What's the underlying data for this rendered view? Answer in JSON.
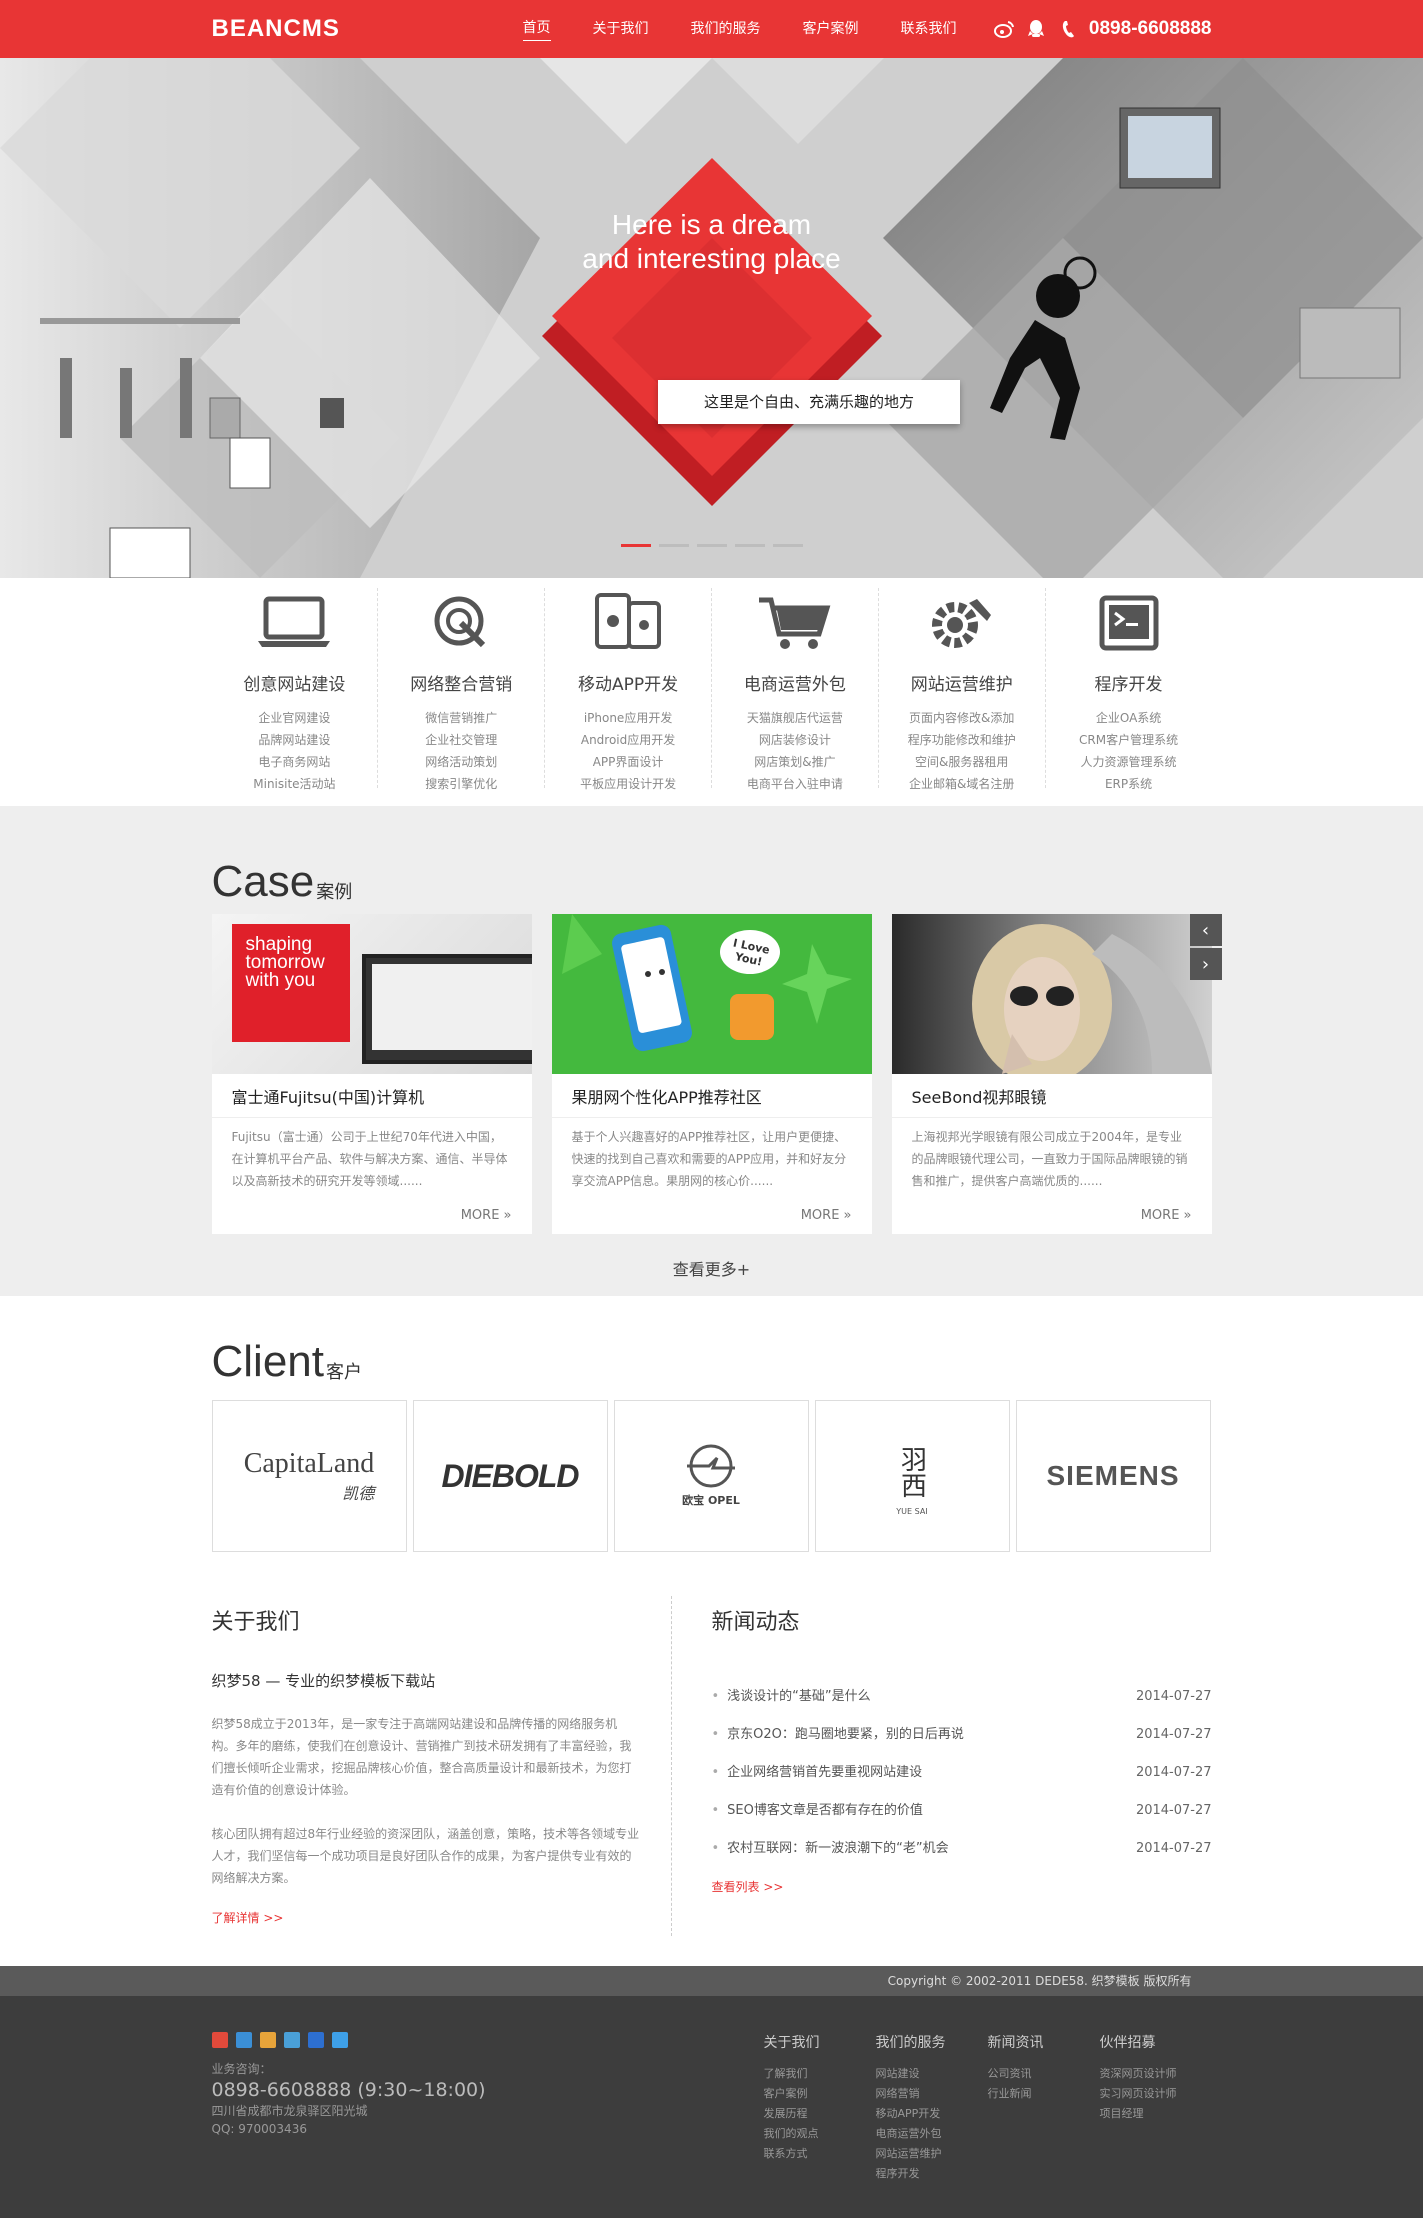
{
  "header": {
    "logo": "BEANCMS",
    "nav": [
      "首页",
      "关于我们",
      "我们的服务",
      "客户案例",
      "联系我们"
    ],
    "phone": "0898-6608888",
    "icons": [
      "weibo-icon",
      "qq-icon",
      "phone-icon"
    ]
  },
  "banner": {
    "headline_1": "Here is a dream",
    "headline_2": "and interesting place",
    "tag": "这里是个自由、充满乐趣的地方",
    "slide_count": 5,
    "active_slide": 1
  },
  "services": [
    {
      "icon": "laptop-icon",
      "title": "创意网站建设",
      "items": [
        "企业官网建设",
        "品牌网站建设",
        "电子商务网站",
        "Minisite活动站"
      ]
    },
    {
      "icon": "target-search-icon",
      "title": "网络整合营销",
      "items": [
        "微信营销推广",
        "企业社交管理",
        "网络活动策划",
        "搜索引擎优化"
      ]
    },
    {
      "icon": "mobile-app-icon",
      "title": "移动APP开发",
      "items": [
        "iPhone应用开发",
        "Android应用开发",
        "APP界面设计",
        "平板应用设计开发"
      ]
    },
    {
      "icon": "shopping-cart-icon",
      "title": "电商运营外包",
      "items": [
        "天猫旗舰店代运营",
        "网店装修设计",
        "网店策划&推广",
        "电商平台入驻申请"
      ]
    },
    {
      "icon": "gear-wrench-icon",
      "title": "网站运营维护",
      "items": [
        "页面内容修改&添加",
        "程序功能修改和维护",
        "空间&服务器租用",
        "企业邮箱&域名注册"
      ]
    },
    {
      "icon": "terminal-icon",
      "title": "程序开发",
      "items": [
        "企业OA系统",
        "CRM客户管理系统",
        "人力资源管理系统",
        "ERP系统"
      ]
    }
  ],
  "case": {
    "title_en": "Case",
    "title_cn": "案例",
    "cards": [
      {
        "title": "富士通Fujitsu(中国)计算机",
        "overlay": "shaping tomorrow with you",
        "desc": "Fujitsu（富士通）公司于上世纪70年代进入中国，在计算机平台产品、软件与解决方案、通信、半导体以及高新技术的研究开发等领域......",
        "more": "MORE »"
      },
      {
        "title": "果朋网个性化APP推荐社区",
        "overlay": "I Love You!",
        "desc": "基于个人兴趣喜好的APP推荐社区，让用户更便捷、快速的找到自己喜欢和需要的APP应用，并和好友分享交流APP信息。果朋网的核心价......",
        "more": "MORE »"
      },
      {
        "title": "SeeBond视邦眼镜",
        "overlay": "",
        "desc": "上海视邦光学眼镜有限公司成立于2004年，是专业的品牌眼镜代理公司，一直致力于国际品牌眼镜的销售和推广，提供客户高端优质的......",
        "more": "MORE »"
      }
    ],
    "prev": "‹",
    "next": "›",
    "more_link": "查看更多+"
  },
  "client": {
    "title_en": "Client",
    "title_cn": "客户",
    "logos": [
      "CapitaLand",
      "DIEBOLD",
      "欧宝 OPEL",
      "羽西",
      "SIEMENS"
    ],
    "capita_cn": "凯德",
    "yuesai_en": "YUE SAI"
  },
  "about": {
    "title": "关于我们",
    "subtitle": "织梦58 — 专业的织梦模板下载站",
    "p1": "织梦58成立于2013年，是一家专注于高端网站建设和品牌传播的网络服务机构。多年的磨练，使我们在创意设计、营销推广到技术研发拥有了丰富经验，我们擅长倾听企业需求，挖掘品牌核心价值，整合高质量设计和最新技术，为您打造有价值的创意设计体验。",
    "p2": "核心团队拥有超过8年行业经验的资深团队，涵盖创意，策略，技术等各领域专业人才，我们坚信每一个成功项目是良好团队合作的成果，为客户提供专业有效的网络解决方案。",
    "link": "了解详情 >>"
  },
  "news": {
    "title": "新闻动态",
    "items": [
      {
        "title": "浅谈设计的“基础”是什么",
        "date": "2014-07-27"
      },
      {
        "title": "京东O2O：跑马圈地要紧，别的日后再说",
        "date": "2014-07-27"
      },
      {
        "title": "企业网络营销首先要重视网站建设",
        "date": "2014-07-27"
      },
      {
        "title": "SEO博客文章是否都有存在的价值",
        "date": "2014-07-27"
      },
      {
        "title": "农村互联网：新一波浪潮下的“老”机会",
        "date": "2014-07-27"
      }
    ],
    "link": "查看列表 >>"
  },
  "footer": {
    "copyright": "Copyright © 2002-2011 DEDE58. 织梦模板 版权所有",
    "share_colors": [
      "#e24a3b",
      "#3b8fd6",
      "#e8a43a",
      "#4aa0d8",
      "#2d6fd0",
      "#3ea0e8"
    ],
    "contact_label": "业务咨询：",
    "contact_phone": "0898-6608888 (9:30~18:00)",
    "address": "四川省成都市龙泉驿区阳光城",
    "qq": "QQ: 970003436",
    "cols": [
      {
        "title": "关于我们",
        "items": [
          "了解我们",
          "客户案例",
          "发展历程",
          "我们的观点",
          "联系方式"
        ]
      },
      {
        "title": "我们的服务",
        "items": [
          "网站建设",
          "网络营销",
          "移动APP开发",
          "电商运营外包",
          "网站运营维护",
          "程序开发"
        ]
      },
      {
        "title": "新闻资讯",
        "items": [
          "公司资讯",
          "行业新闻"
        ]
      },
      {
        "title": "伙伴招募",
        "items": [
          "资深网页设计师",
          "实习网页设计师",
          "项目经理"
        ]
      }
    ]
  },
  "colors": {
    "brand_red": "#e83535",
    "bg_grey": "#eeeeee",
    "footer_dark": "#3d3d3d"
  }
}
